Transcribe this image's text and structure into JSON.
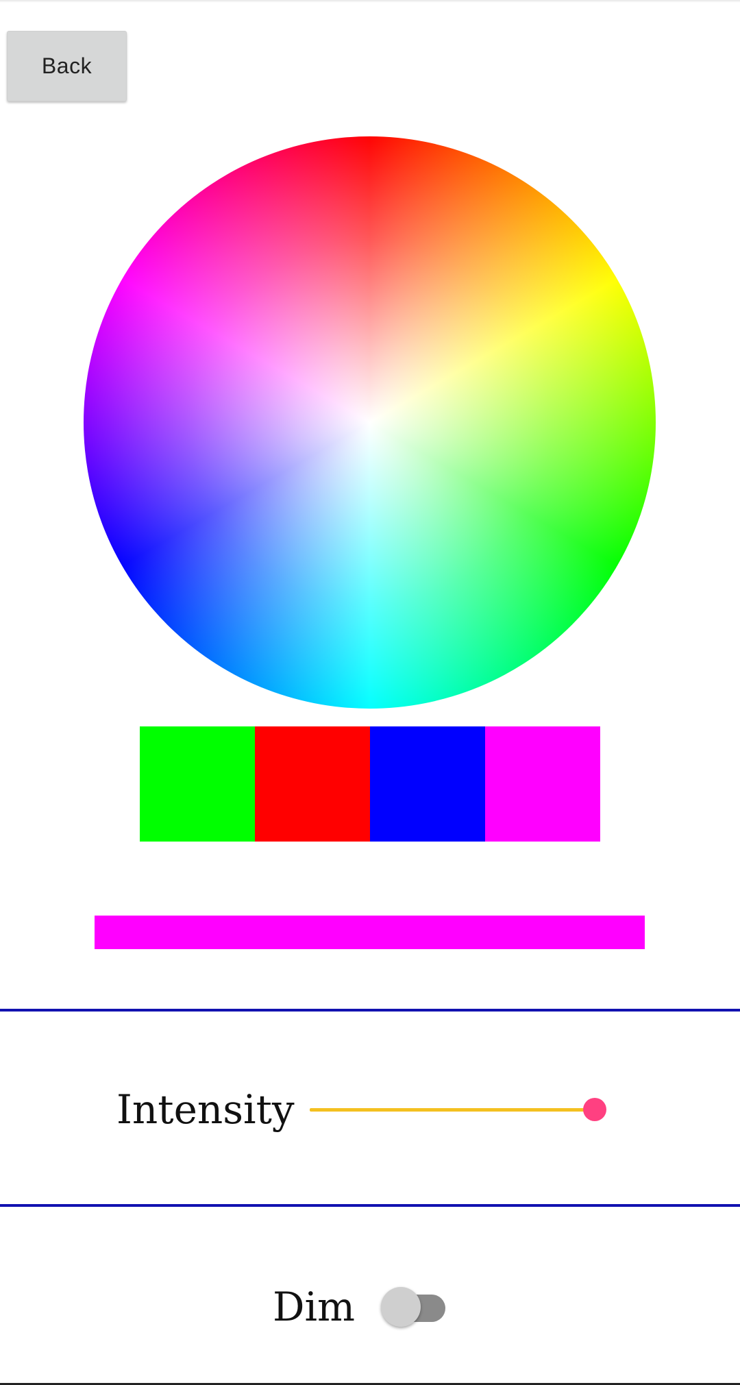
{
  "header": {
    "back_label": "Back"
  },
  "color_wheel": {
    "icon": "color-wheel"
  },
  "swatches": [
    {
      "color": "#00ff00"
    },
    {
      "color": "#ff0000"
    },
    {
      "color": "#0000ff"
    },
    {
      "color": "#ff00ff"
    }
  ],
  "selected_color": "#ff00ff",
  "intensity": {
    "label": "Intensity",
    "value_fraction": 0.97,
    "track_color": "#f4c020",
    "thumb_color": "#ff4081"
  },
  "dim": {
    "label": "Dim",
    "checked": false
  },
  "colors": {
    "divider": "#1212b0"
  }
}
